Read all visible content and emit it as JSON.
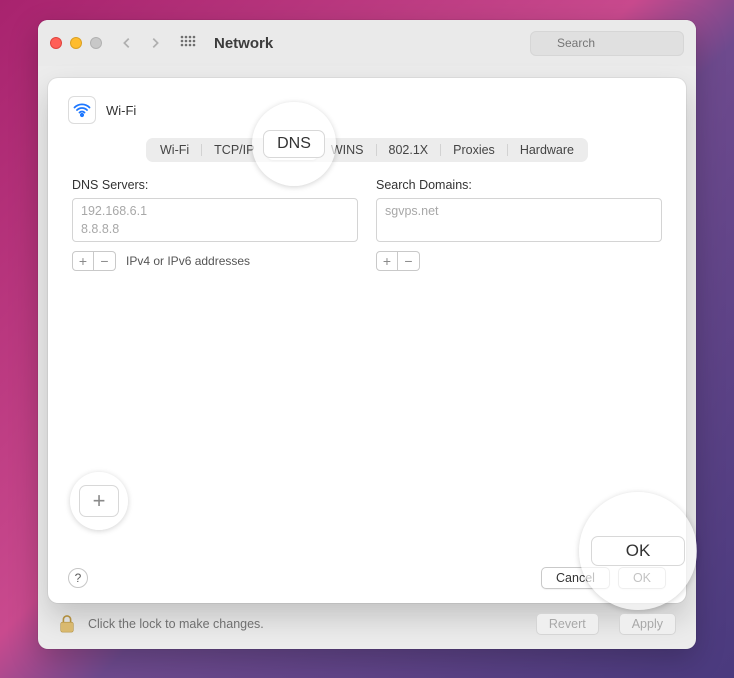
{
  "window": {
    "title": "Network",
    "search_placeholder": "Search"
  },
  "sheet": {
    "interface": "Wi-Fi",
    "tabs": [
      "Wi-Fi",
      "TCP/IP",
      "DNS",
      "WINS",
      "802.1X",
      "Proxies",
      "Hardware"
    ],
    "selected_tab_index": 2,
    "left": {
      "label": "DNS Servers:",
      "items": [
        "192.168.6.1",
        "8.8.8.8"
      ],
      "hint": "IPv4 or IPv6 addresses"
    },
    "right": {
      "label": "Search Domains:",
      "items": [
        "sgvps.net"
      ]
    },
    "help": "?",
    "cancel_label": "Cancel",
    "ok_label": "OK"
  },
  "bottom": {
    "lock_text": "Click the lock to make changes.",
    "revert_label": "Revert",
    "apply_label": "Apply"
  },
  "callouts": {
    "dns": "DNS",
    "plus": "+",
    "ok": "OK"
  }
}
